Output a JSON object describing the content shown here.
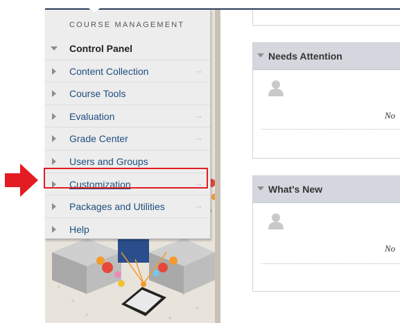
{
  "sidebar": {
    "heading": "COURSE MANAGEMENT",
    "control_panel": "Control Panel",
    "items": [
      {
        "label": "Content Collection",
        "arrow": "→"
      },
      {
        "label": "Course Tools",
        "arrow": ""
      },
      {
        "label": "Evaluation",
        "arrow": "→"
      },
      {
        "label": "Grade Center",
        "arrow": "→"
      },
      {
        "label": "Users and Groups",
        "arrow": ""
      },
      {
        "label": "Customization",
        "arrow": "→"
      },
      {
        "label": "Packages and Utilities",
        "arrow": "→"
      },
      {
        "label": "Help",
        "arrow": ""
      }
    ]
  },
  "main": {
    "needs_attention": {
      "title": "Needs Attention",
      "message": "No"
    },
    "whats_new": {
      "title": "What's New",
      "message": "No"
    }
  },
  "annotation": {
    "color": "#e31b23",
    "target": "Customization"
  },
  "icons": [
    "triangle-right-icon",
    "triangle-down-icon",
    "arrow-right-icon",
    "user-avatar-icon",
    "red-pointer-arrow-icon"
  ]
}
